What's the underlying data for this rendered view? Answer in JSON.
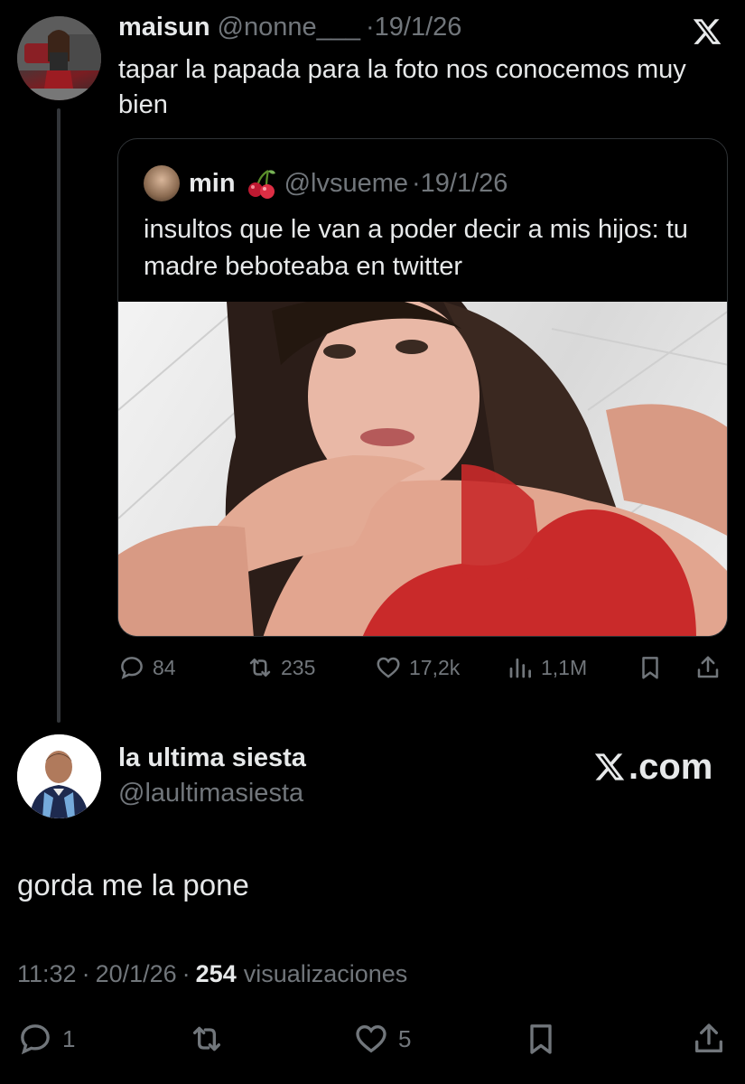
{
  "tweet": {
    "author_name": "maisun",
    "handle": "@nonne___",
    "separator": "·",
    "date": "19/1/26",
    "text": "tapar la papada para la foto nos conocemos muy bien",
    "quote": {
      "author_name": "min",
      "emoji": "cherries-icon",
      "handle": "@lvsueme",
      "separator": "·",
      "date": "19/1/26",
      "text": "insultos que le van a poder decir a mis hijos: tu madre beboteaba en twitter"
    },
    "stats": {
      "replies": "84",
      "retweets": "235",
      "likes": "17,2k",
      "views": "1,1M"
    }
  },
  "reply": {
    "author_name": "la ultima siesta",
    "handle": "@laultimasiesta",
    "brand": ".com",
    "text": "gorda me la pone",
    "time": "11:32",
    "separator1": "·",
    "date": "20/1/26",
    "separator2": "·",
    "views_count": "254",
    "views_label": "visualizaciones",
    "stats": {
      "replies": "1",
      "likes": "5"
    }
  },
  "colors": {
    "background": "#000000",
    "text": "#e7e9ea",
    "secondary": "#71767b",
    "border": "#2f3336"
  }
}
